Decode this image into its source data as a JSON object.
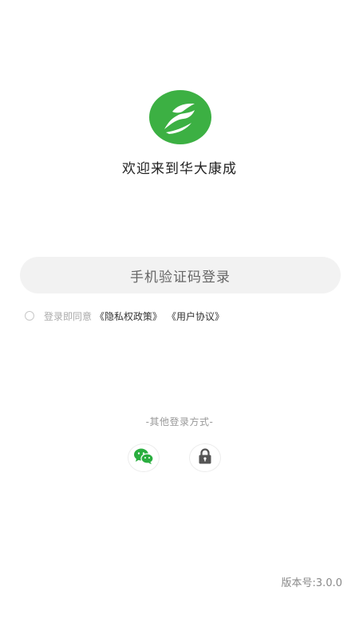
{
  "welcome": {
    "title": "欢迎来到华大康成"
  },
  "login": {
    "sms_button": "手机验证码登录"
  },
  "agreement": {
    "prefix": "登录即同意",
    "privacy_link": "《隐私权政策》",
    "user_link": "《用户协议》"
  },
  "other_login": {
    "label": "-其他登录方式-"
  },
  "footer": {
    "version": "版本号:3.0.0"
  },
  "colors": {
    "brand_green": "#3cb043",
    "wechat_green": "#2aae3f",
    "button_bg": "#f2f2f2"
  },
  "icons": {
    "logo": "leaf-logo-icon",
    "wechat": "wechat-icon",
    "lock": "lock-icon"
  }
}
